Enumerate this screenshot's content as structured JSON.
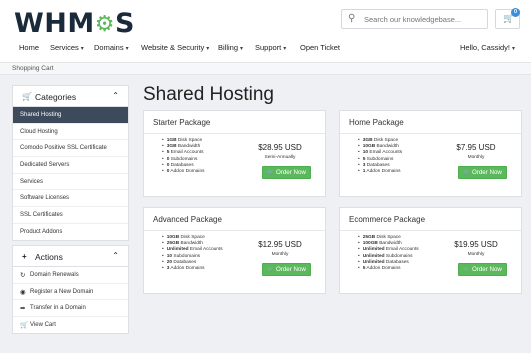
{
  "header": {
    "logo_text": "WHM",
    "logo_gear": "⚙",
    "logo_suffix": "S",
    "search": {
      "placeholder": "Search our knowledgebase...",
      "icon": "search-icon"
    },
    "cart": {
      "icon": "cart-icon",
      "count": "0"
    }
  },
  "nav": {
    "items": [
      {
        "label": "Home",
        "dropdown": false
      },
      {
        "label": "Services",
        "dropdown": true
      },
      {
        "label": "Domains",
        "dropdown": true
      },
      {
        "label": "Website & Security",
        "dropdown": true
      },
      {
        "label": "Billing",
        "dropdown": true
      },
      {
        "label": "Support",
        "dropdown": true
      },
      {
        "label": "Open Ticket",
        "dropdown": false
      }
    ],
    "user": "Hello, Cassidy!"
  },
  "breadcrumb": "Shopping Cart",
  "sidebar": {
    "categories": {
      "title": "Categories",
      "icon": "cart-icon",
      "items": [
        {
          "label": "Shared Hosting",
          "active": true
        },
        {
          "label": "Cloud Hosting"
        },
        {
          "label": "Comodo Positive SSL Certificate"
        },
        {
          "label": "Dedicated Servers"
        },
        {
          "label": "Services"
        },
        {
          "label": "Software Licenses"
        },
        {
          "label": "SSL Certificates"
        },
        {
          "label": "Product Addons"
        }
      ]
    },
    "actions": {
      "title": "Actions",
      "icon": "plus-icon",
      "items": [
        {
          "label": "Domain Renewals",
          "icon": "refresh-icon"
        },
        {
          "label": "Register a New Domain",
          "icon": "globe-icon"
        },
        {
          "label": "Transfer in a Domain",
          "icon": "share-icon"
        },
        {
          "label": "View Cart",
          "icon": "cart-icon"
        }
      ]
    }
  },
  "main": {
    "title": "Shared Hosting",
    "order_label": "Order Now",
    "products": [
      {
        "name": "Starter Package",
        "price": "$28.95 USD",
        "cycle": "Semi-Annually",
        "features": [
          [
            "1GB",
            " Disk Space"
          ],
          [
            "3GB",
            " Bandwidth"
          ],
          [
            "5",
            " Email Accounts"
          ],
          [
            "0",
            " Subdomains"
          ],
          [
            "0",
            " Databases"
          ],
          [
            "0",
            " Addon Domains"
          ]
        ]
      },
      {
        "name": "Home Package",
        "price": "$7.95 USD",
        "cycle": "Monthly",
        "features": [
          [
            "3GB",
            " Disk Space"
          ],
          [
            "10GB",
            " Bandwidth"
          ],
          [
            "10",
            " Email Accounts"
          ],
          [
            "5",
            " Subdomains"
          ],
          [
            "3",
            " Databases"
          ],
          [
            "1",
            " Addon Domains"
          ]
        ]
      },
      {
        "name": "Advanced Package",
        "price": "$12.95 USD",
        "cycle": "Monthly",
        "features": [
          [
            "10GB",
            " Disk Space"
          ],
          [
            "25GB",
            " Bandwidth"
          ],
          [
            "Unlimited",
            " Email Accounts"
          ],
          [
            "10",
            " Subdomains"
          ],
          [
            "20",
            " Databases"
          ],
          [
            "3",
            " Addon Domains"
          ]
        ]
      },
      {
        "name": "Ecommerce Package",
        "price": "$19.95 USD",
        "cycle": "Monthly",
        "features": [
          [
            "25GB",
            " Disk Space"
          ],
          [
            "100GB",
            " Bandwidth"
          ],
          [
            "Unlimited",
            " Email Accounts"
          ],
          [
            "Unlimited",
            " Subdomains"
          ],
          [
            "Unlimited",
            " Databases"
          ],
          [
            "5",
            " Addon Domains"
          ]
        ]
      }
    ]
  },
  "colors": {
    "brand_green": "#5cb85c",
    "active_sidebar": "#3c4a5c",
    "badge_blue": "#3a8fd9",
    "page_bg": "#eef0f3"
  }
}
